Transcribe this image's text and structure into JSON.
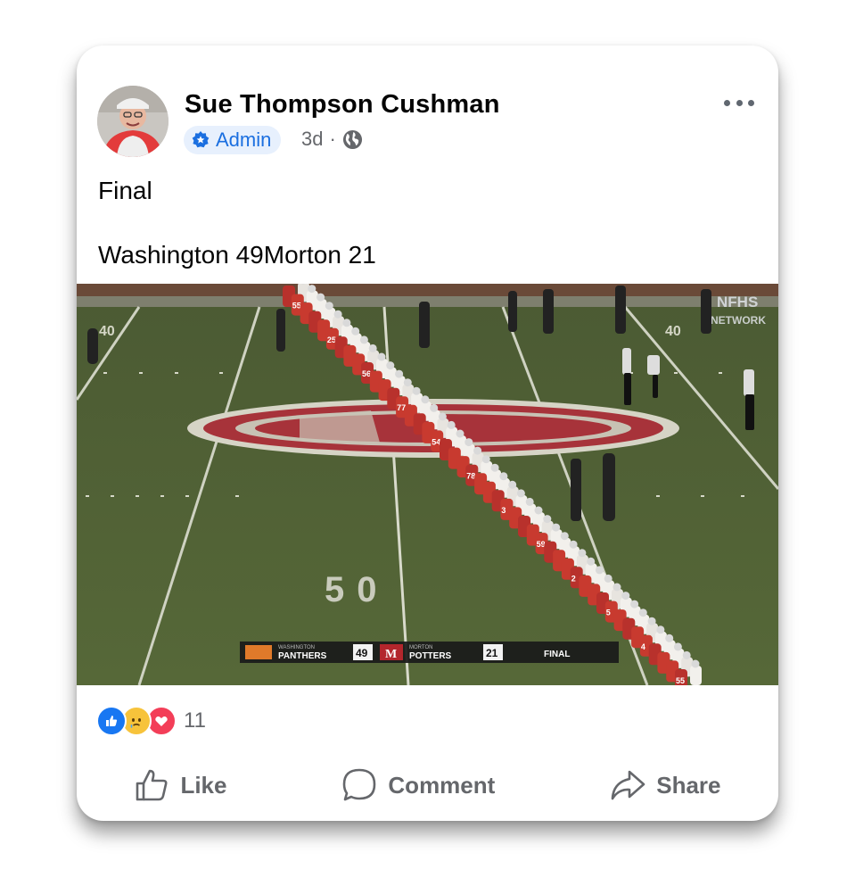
{
  "post": {
    "author": "Sue Thompson Cushman",
    "badge": "Admin",
    "time": "3d",
    "separator": "·",
    "privacy_icon": "globe-icon",
    "more_icon": "more-options-icon",
    "text_line1": "Final",
    "text_line2": "Washington 49Morton 21"
  },
  "photo": {
    "watermark_line1": "NFHS",
    "watermark_line2": "NETWORK",
    "yard_marker": "50",
    "field_numbers": [
      "40",
      "40"
    ],
    "scoreboard": {
      "team1_school": "WASHINGTON",
      "team1_name": "PANTHERS",
      "team1_score": "49",
      "team2_school": "MORTON",
      "team2_name": "POTTERS",
      "team2_score": "21",
      "status": "FINAL"
    },
    "jersey_numbers": [
      "55",
      "25",
      "56",
      "77",
      "54",
      "78",
      "3",
      "59",
      "2",
      "5",
      "4"
    ]
  },
  "reactions": {
    "icons": [
      "like-reaction-icon",
      "sad-reaction-icon",
      "love-reaction-icon"
    ],
    "count": "11"
  },
  "actions": {
    "like": "Like",
    "comment": "Comment",
    "share": "Share"
  },
  "colors": {
    "accent": "#1b6fe0",
    "like_blue": "#1877f2",
    "love_red": "#f33e58",
    "muted": "#65676b"
  }
}
